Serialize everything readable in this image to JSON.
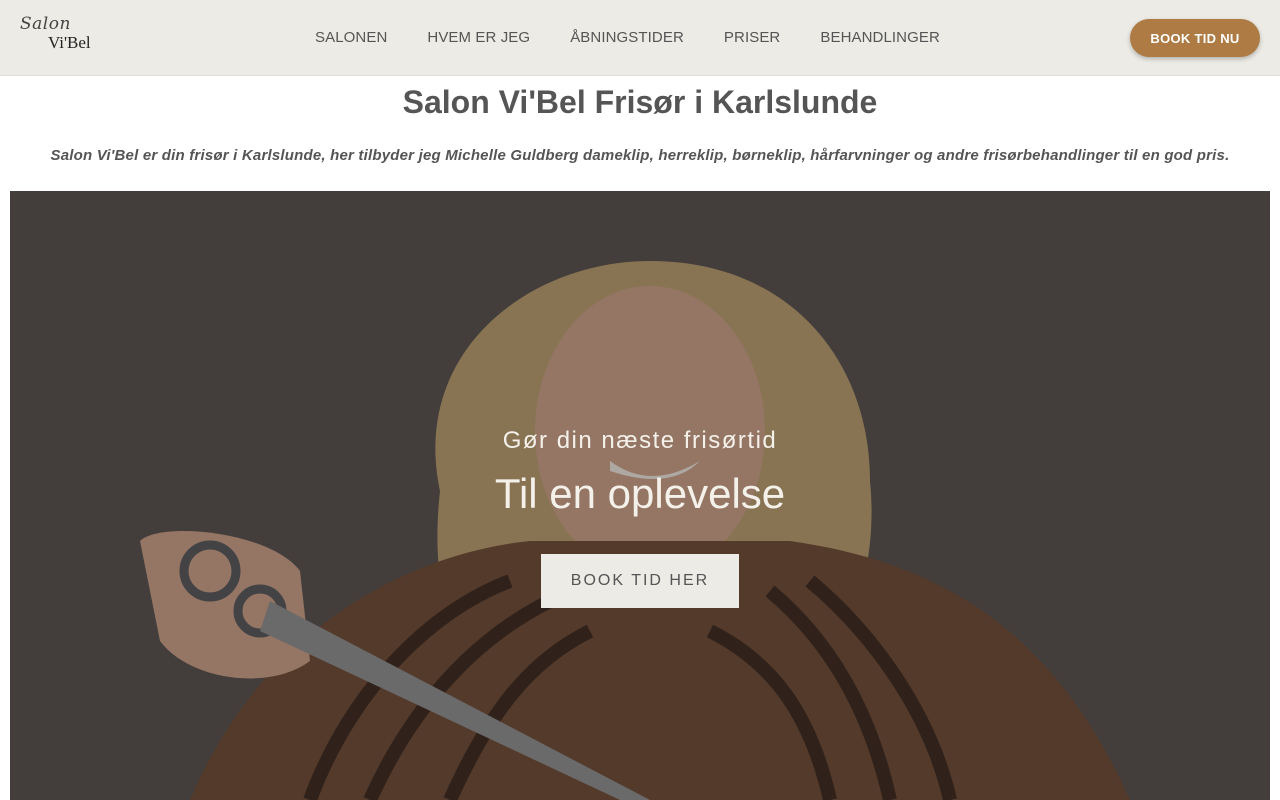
{
  "header": {
    "logo_line1": "Salon",
    "logo_line2": "Vi'Bel",
    "nav": [
      "SALONEN",
      "HVEM ER JEG",
      "ÅBNINGSTIDER",
      "PRISER",
      "BEHANDLINGER"
    ],
    "book_button": "BOOK TID NU"
  },
  "main": {
    "title": "Salon Vi'Bel Frisør i Karlslunde",
    "intro": "Salon Vi'Bel er din frisør i Karlslunde, her tilbyder jeg Michelle Guldberg dameklip, herreklip, børneklip, hårfarvninger og andre frisørbehandlinger til en god pris."
  },
  "hero": {
    "subtitle": "Gør din næste frisørtid",
    "title": "Til en oplevelse",
    "button": "BOOK TID HER"
  },
  "colors": {
    "header_bg": "#ecebe5",
    "accent": "#ad7b43",
    "text": "#555555"
  }
}
